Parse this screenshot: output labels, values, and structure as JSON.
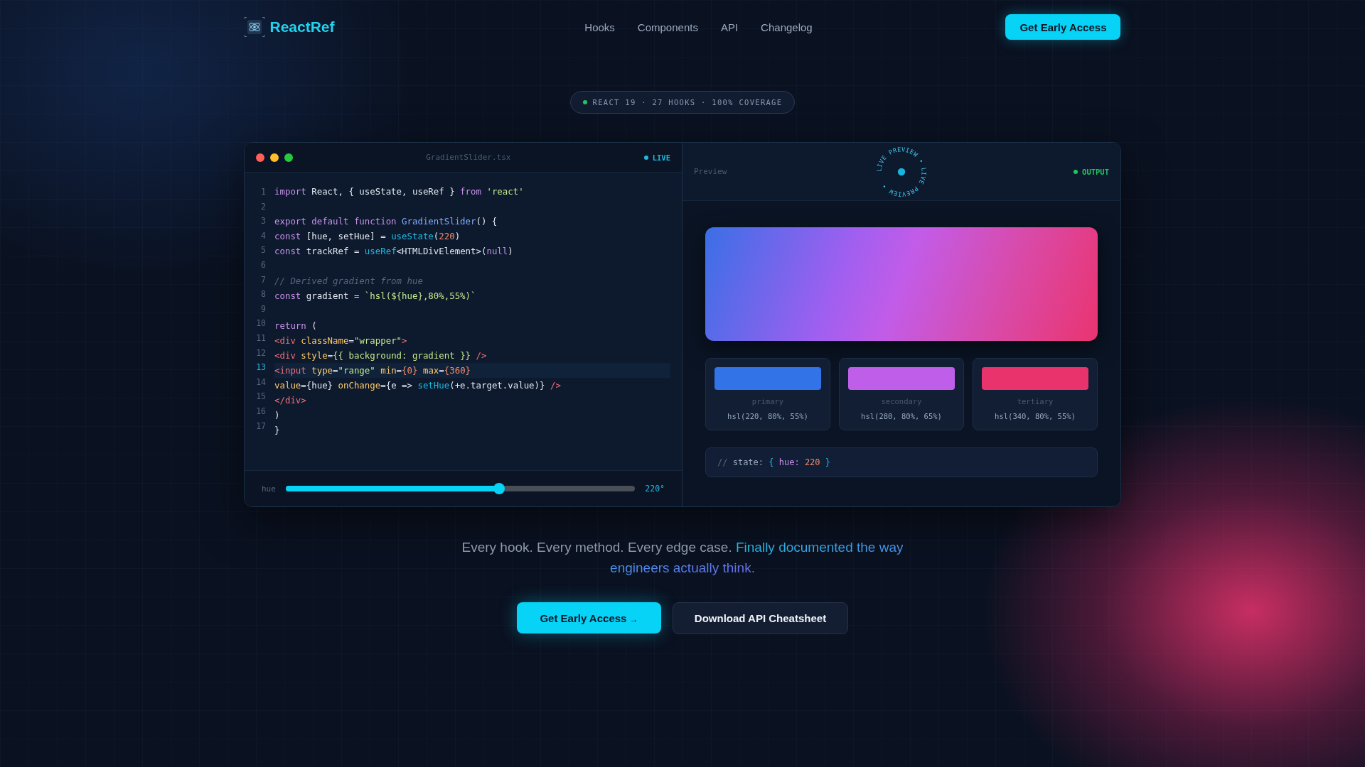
{
  "nav": {
    "brand": "ReactRef",
    "links": [
      "Hooks",
      "Components",
      "API",
      "Changelog"
    ],
    "cta": "Get Early Access"
  },
  "badge": {
    "text": "REACT 19 · 27 HOOKS · 100% COVERAGE"
  },
  "editor": {
    "filename": "GradientSlider.tsx",
    "status": "LIVE",
    "line_numbers": [
      {
        "n": "1",
        "active": false
      },
      {
        "n": "2",
        "active": false
      },
      {
        "n": "3",
        "active": false
      },
      {
        "n": "4",
        "active": false
      },
      {
        "n": "5",
        "active": false
      },
      {
        "n": "6",
        "active": false
      },
      {
        "n": "7",
        "active": false
      },
      {
        "n": "8",
        "active": false
      },
      {
        "n": "9",
        "active": false
      },
      {
        "n": "10",
        "active": false
      },
      {
        "n": "11",
        "active": false
      },
      {
        "n": "12",
        "active": false
      },
      {
        "n": "13",
        "active": true
      },
      {
        "n": "14",
        "active": false
      },
      {
        "n": "15",
        "active": false
      },
      {
        "n": "16",
        "active": false
      },
      {
        "n": "17",
        "active": false
      }
    ],
    "lines": [
      {
        "highlighted": false,
        "tokens": [
          {
            "kind": "kw",
            "t": "import"
          },
          {
            "kind": "plain",
            "t": " React, { useState, useRef } "
          },
          {
            "kind": "kw",
            "t": "from "
          },
          {
            "kind": "str",
            "t": "'react'"
          }
        ]
      },
      {
        "highlighted": false
      },
      {
        "highlighted": false,
        "tokens": [
          {
            "kind": "kw",
            "t": "export default function "
          },
          {
            "kind": "fn",
            "t": "GradientSlider"
          },
          {
            "kind": "plain",
            "t": "() {"
          }
        ]
      },
      {
        "highlighted": false,
        "tokens": [
          {
            "kind": "kw",
            "t": "const"
          },
          {
            "kind": "plain",
            "t": " [hue, setHue] = "
          },
          {
            "kind": "call",
            "t": "useState"
          },
          {
            "kind": "plain",
            "t": "("
          },
          {
            "kind": "num",
            "t": "220"
          },
          {
            "kind": "plain",
            "t": ")"
          }
        ]
      },
      {
        "highlighted": false,
        "tokens": [
          {
            "kind": "kw",
            "t": "const"
          },
          {
            "kind": "plain",
            "t": " trackRef = "
          },
          {
            "kind": "call",
            "t": "useRef"
          },
          {
            "kind": "plain",
            "t": "<HTMLDivElement>("
          },
          {
            "kind": "kw",
            "t": "null"
          },
          {
            "kind": "plain",
            "t": ")"
          }
        ]
      },
      {
        "highlighted": false
      },
      {
        "highlighted": false,
        "tokens": [
          {
            "kind": "comment",
            "t": "// Derived gradient from hue"
          }
        ]
      },
      {
        "highlighted": false,
        "tokens": [
          {
            "kind": "kw",
            "t": "const"
          },
          {
            "kind": "plain",
            "t": " gradient = "
          },
          {
            "kind": "str",
            "t": "`hsl(${hue},80%,55%)`"
          }
        ]
      },
      {
        "highlighted": false
      },
      {
        "highlighted": false,
        "tokens": [
          {
            "kind": "kw",
            "t": "return"
          },
          {
            "kind": "plain",
            "t": " ("
          }
        ]
      },
      {
        "highlighted": false,
        "tokens": [
          {
            "kind": "tag",
            "t": "<div "
          },
          {
            "kind": "attr",
            "t": "className"
          },
          {
            "kind": "plain",
            "t": "="
          },
          {
            "kind": "str",
            "t": "\"wrapper\""
          },
          {
            "kind": "tag",
            "t": ">"
          }
        ]
      },
      {
        "highlighted": false,
        "tokens": [
          {
            "kind": "tag",
            "t": "<div "
          },
          {
            "kind": "attr",
            "t": "style"
          },
          {
            "kind": "plain",
            "t": "="
          },
          {
            "kind": "str",
            "t": "{{ background: gradient }} "
          },
          {
            "kind": "tag",
            "t": "/>"
          }
        ]
      },
      {
        "highlighted": true,
        "tokens": [
          {
            "kind": "tag",
            "t": "<input "
          },
          {
            "kind": "attr",
            "t": "type"
          },
          {
            "kind": "plain",
            "t": "="
          },
          {
            "kind": "str",
            "t": "\"range\" "
          },
          {
            "kind": "attr",
            "t": "min"
          },
          {
            "kind": "plain",
            "t": "="
          },
          {
            "kind": "num",
            "t": "{0} "
          },
          {
            "kind": "attr",
            "t": "max"
          },
          {
            "kind": "plain",
            "t": "="
          },
          {
            "kind": "num",
            "t": "{360}"
          }
        ]
      },
      {
        "highlighted": false,
        "tokens": [
          {
            "kind": "attr",
            "t": "value"
          },
          {
            "kind": "plain",
            "t": "={hue} "
          },
          {
            "kind": "attr",
            "t": "onChange"
          },
          {
            "kind": "plain",
            "t": "={e => "
          },
          {
            "kind": "call",
            "t": "setHue"
          },
          {
            "kind": "plain",
            "t": "(+e.target.value)} "
          },
          {
            "kind": "tag",
            "t": "/>"
          }
        ]
      },
      {
        "highlighted": false,
        "tokens": [
          {
            "kind": "tag",
            "t": "</div>"
          }
        ]
      },
      {
        "highlighted": false,
        "tokens": [
          {
            "kind": "plain",
            "t": ")"
          }
        ]
      },
      {
        "highlighted": false,
        "tokens": [
          {
            "kind": "plain",
            "t": "}"
          }
        ]
      }
    ],
    "slider": {
      "label": "hue",
      "level": 0.61,
      "reading": "220°"
    }
  },
  "preview": {
    "label": "Preview",
    "ring_text": "LIVE PREVIEW • LIVE PREVIEW • ",
    "status": "OUTPUT",
    "swatches": [
      {
        "name": "primary",
        "value": "hsl(220, 80%, 55%)",
        "color": "#3373e8"
      },
      {
        "name": "secondary",
        "value": "hsl(280, 80%, 65%)",
        "color": "#bf5fe9"
      },
      {
        "name": "tertiary",
        "value": "hsl(340, 80%, 55%)",
        "color": "#e8336d"
      }
    ],
    "state": {
      "comment": "//",
      "key": "state:",
      "open": "{",
      "field": "hue:",
      "value": "220",
      "close": "}"
    }
  },
  "tagline": {
    "text": "Every hook. Every method. Every edge case.",
    "highlight": "Finally documented the way engineers actually think."
  },
  "buttons": {
    "primary": "Get Early Access",
    "primary_arrow": "→",
    "secondary": "Download API Cheatsheet"
  }
}
